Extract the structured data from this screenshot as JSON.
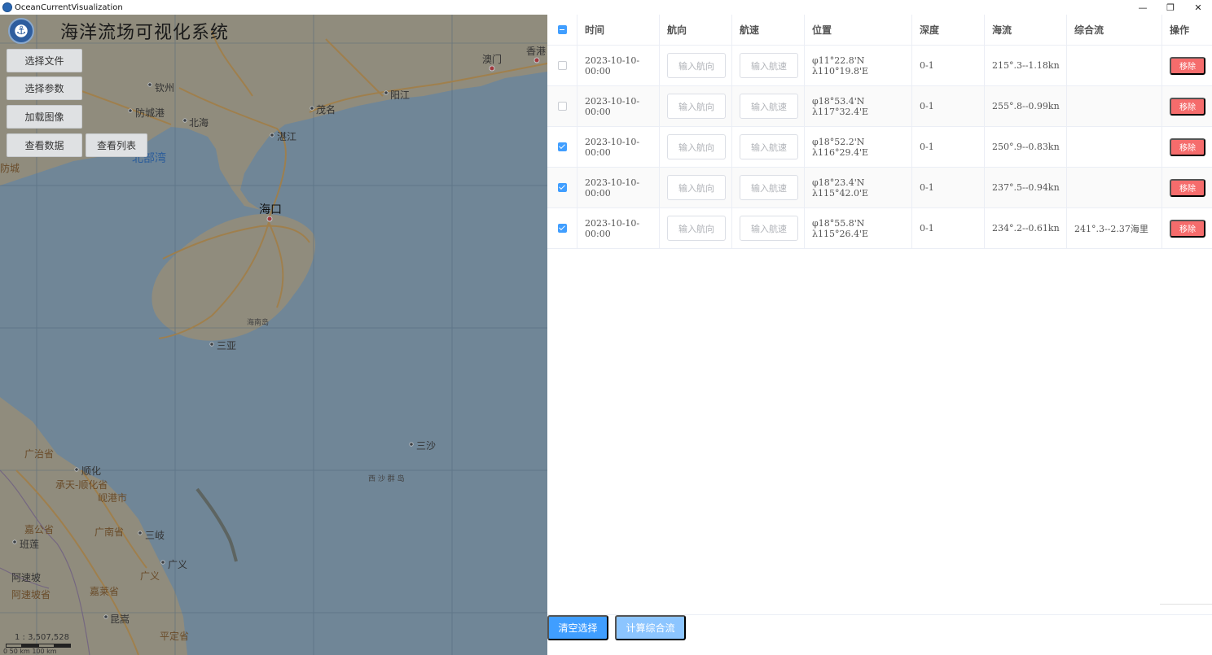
{
  "window": {
    "title": "OceanCurrentVisualization",
    "minimize": "—",
    "restore": "❐",
    "close": "✕"
  },
  "brand": {
    "title": "海洋流场可视化系统"
  },
  "map_buttons": {
    "select_file": "选择文件",
    "select_params": "选择参数",
    "load_image": "加载图像",
    "view_data": "查看数据",
    "view_list": "查看列表"
  },
  "map_labels": {
    "macau": "澳门",
    "hongkong": "香港",
    "qinzhou": "钦州",
    "yangjiang": "阳江",
    "fangchenggang": "防城港",
    "beihai": "北海",
    "maoming": "茂名",
    "zhanjiang": "湛江",
    "beibu_gulf": "北部湾",
    "haikou": "海口",
    "hainan_island": "海南岛",
    "sanya": "三亚",
    "sansha": "三沙",
    "xisha": "西 沙 群 岛",
    "shunhua": "顺化",
    "thuathien": "承天-顺化省",
    "xiangshan": "岘港市",
    "quangnam": "广南省",
    "sanqi": "三岐",
    "banlian": "班莲",
    "guangyi": "广义",
    "gongsheng": "嘉公省",
    "asupo": "阿速坡",
    "asupo_prov": "阿速坡省",
    "kunsong": "昆嵩",
    "pingding": "平定省",
    "yilai": "嘉莱省",
    "guangzhi": "广治省",
    "fangcheng_west": "防城"
  },
  "scale": {
    "ratio": "1 : 3,507,528",
    "labels": "0    50 km  100 km"
  },
  "table": {
    "headers": {
      "time": "时间",
      "heading": "航向",
      "speed": "航速",
      "position": "位置",
      "depth": "深度",
      "current": "海流",
      "combined": "综合流",
      "action": "操作"
    },
    "heading_placeholder": "输入航向",
    "speed_placeholder": "输入航速",
    "remove_label": "移除",
    "rows": [
      {
        "checked": false,
        "time": "2023-10-10-00:00",
        "position": "φ11°22.8'N λ110°19.8'E",
        "depth": "0-1",
        "current": "215°.3--1.18kn",
        "combined": ""
      },
      {
        "checked": false,
        "time": "2023-10-10-00:00",
        "position": "φ18°53.4'N λ117°32.4'E",
        "depth": "0-1",
        "current": "255°.8--0.99kn",
        "combined": ""
      },
      {
        "checked": true,
        "time": "2023-10-10-00:00",
        "position": "φ18°52.2'N λ116°29.4'E",
        "depth": "0-1",
        "current": "250°.9--0.83kn",
        "combined": ""
      },
      {
        "checked": true,
        "time": "2023-10-10-00:00",
        "position": "φ18°23.4'N λ115°42.0'E",
        "depth": "0-1",
        "current": "237°.5--0.94kn",
        "combined": ""
      },
      {
        "checked": true,
        "time": "2023-10-10-00:00",
        "position": "φ18°55.8'N λ115°26.4'E",
        "depth": "0-1",
        "current": "234°.2--0.61kn",
        "combined": "241°.3--2.37海里"
      }
    ]
  },
  "footer": {
    "clear_selection": "清空选择",
    "calc_combined": "计算综合流"
  },
  "colors": {
    "primary": "#409eff",
    "primary_light": "#8cc5ff",
    "danger": "#f56c6c",
    "sea": "#7f99ad",
    "land": "#b7ae97"
  }
}
